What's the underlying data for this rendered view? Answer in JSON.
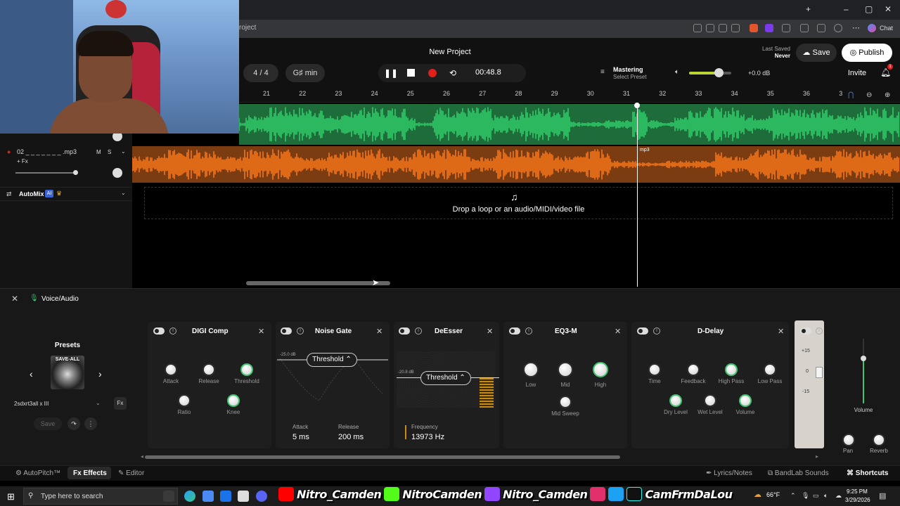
{
  "browser": {
    "address_partial": "roject",
    "chat_label": "Chat"
  },
  "header": {
    "project_title": "New Project",
    "time_signature": "4 / 4",
    "key": "G♯ min",
    "time_display": "00:48.8",
    "mastering_label": "Mastering",
    "mastering_sub": "Select Preset",
    "volume_db": "+0.0 dB",
    "volume_level_percent": 70,
    "last_saved_label": "Last Saved",
    "last_saved_value": "Never",
    "save_label": "Save",
    "publish_label": "Publish",
    "invite_label": "Invite",
    "notification_count": "1"
  },
  "ruler": {
    "bars": [
      "21",
      "22",
      "23",
      "24",
      "25",
      "26",
      "27",
      "28",
      "29",
      "30",
      "31",
      "32",
      "33",
      "34",
      "35",
      "36",
      "3"
    ]
  },
  "tracks": {
    "track2_name": "02 _ _ _ _ _ _ _ .mp3",
    "track2_fx": "+ Fx",
    "track2_mute": "M",
    "track2_solo": "S",
    "track2_clip_label": "mp3",
    "automix_label": "AutoMix",
    "automix_ai": "AI",
    "drop_text": "Drop a loop or an audio/MIDI/video file"
  },
  "fx_panel": {
    "title": "Voice/Audio",
    "presets_label": "Presets",
    "preset_name": "2sdxrt3all x III",
    "preset_art_text": "SAVE-ALL",
    "save_label": "Save",
    "cards": {
      "digi_comp": {
        "title": "DIGI Comp",
        "knobs": [
          "Attack",
          "Release",
          "Threshold",
          "Ratio",
          "Knee"
        ]
      },
      "noise_gate": {
        "title": "Noise Gate",
        "db_readout": "-25.0 dB",
        "threshold_label": "Threshold",
        "attack_label": "Attack",
        "attack_value": "5 ms",
        "release_label": "Release",
        "release_value": "200 ms"
      },
      "deesser": {
        "title": "DeEsser",
        "db_readout": "-20.8 dB",
        "threshold_label": "Threshold",
        "frequency_label": "Frequency",
        "frequency_value": "13973 Hz"
      },
      "eq3m": {
        "title": "EQ3-M",
        "knobs": [
          "Low",
          "Mid",
          "High",
          "Mid Sweep"
        ]
      },
      "ddelay": {
        "title": "D-Delay",
        "knobs": [
          "Time",
          "Feedback",
          "High Pass",
          "Low Pass",
          "Dry Level",
          "Wet Level",
          "Volume"
        ]
      }
    },
    "strip_scale": [
      "+15",
      "0",
      "-15"
    ],
    "volume_label": "Volume",
    "pan_label": "Pan",
    "reverb_label": "Reverb"
  },
  "bottom_bar": {
    "autopitch": "AutoPitch™",
    "effects": "Effects",
    "editor": "Editor",
    "lyrics": "Lyrics/Notes",
    "sounds": "BandLab Sounds",
    "shortcuts": "Shortcuts"
  },
  "taskbar": {
    "search_placeholder": "Type here to search",
    "social": [
      "Nitro_Camden",
      "NitroCamden",
      "Nitro_Camden",
      "CamFrmDaLou"
    ],
    "weather": "66°F",
    "time": "9:25 PM",
    "date": "3/29/2026"
  },
  "colors": {
    "track1_wave": "#32d26a",
    "track2_wave": "#ff7a1a",
    "accent_green": "#3fc46f",
    "record_red": "#e0201a"
  }
}
